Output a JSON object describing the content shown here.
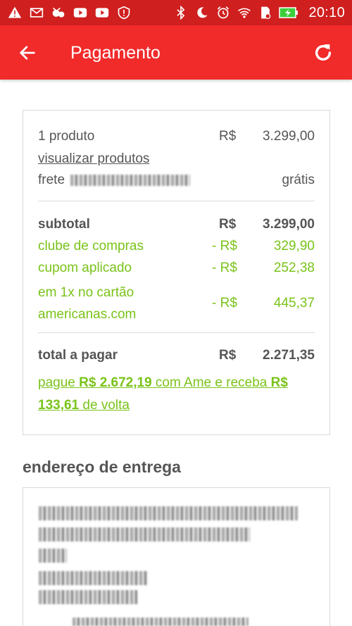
{
  "status_bar": {
    "time": "20:10",
    "left_icons": [
      "warning-icon",
      "mail-icon",
      "missed-call-icon",
      "youtube-icon",
      "youtube-icon",
      "shield-icon"
    ],
    "right_icons": [
      "bluetooth-icon",
      "moon-icon",
      "alarm-icon",
      "wifi-icon",
      "sim-icon",
      "battery-charging-icon"
    ]
  },
  "header": {
    "title": "Pagamento"
  },
  "summary": {
    "products": {
      "label": "1 produto",
      "currency": "R$",
      "value": "3.299,00"
    },
    "view_products_link": "visualizar produtos",
    "shipping": {
      "label": "frete",
      "value": "grátis"
    },
    "subtotal": {
      "label": "subtotal",
      "currency": "R$",
      "value": "3.299,00"
    },
    "discounts": [
      {
        "label": "clube de compras",
        "currency": "- R$",
        "value": "329,90"
      },
      {
        "label": "cupom aplicado",
        "currency": "- R$",
        "value": "252,38"
      },
      {
        "label": "em 1x no cartão americanas.com",
        "currency": "- R$",
        "value": "445,37"
      }
    ],
    "total": {
      "label": "total a pagar",
      "currency": "R$",
      "value": "2.271,35"
    },
    "ame_offer": {
      "part1": "pague ",
      "amount1": "R$ 2.672,19",
      "part2": " com Ame e receba ",
      "amount2": "R$ 133,61",
      "part3": " de volta"
    }
  },
  "address_section": {
    "title": "endereço de entrega"
  },
  "colors": {
    "status_bar": "#d01f1f",
    "app_bar": "#f12a2a",
    "discount_green": "#7ac31a",
    "text_gray": "#555555"
  }
}
